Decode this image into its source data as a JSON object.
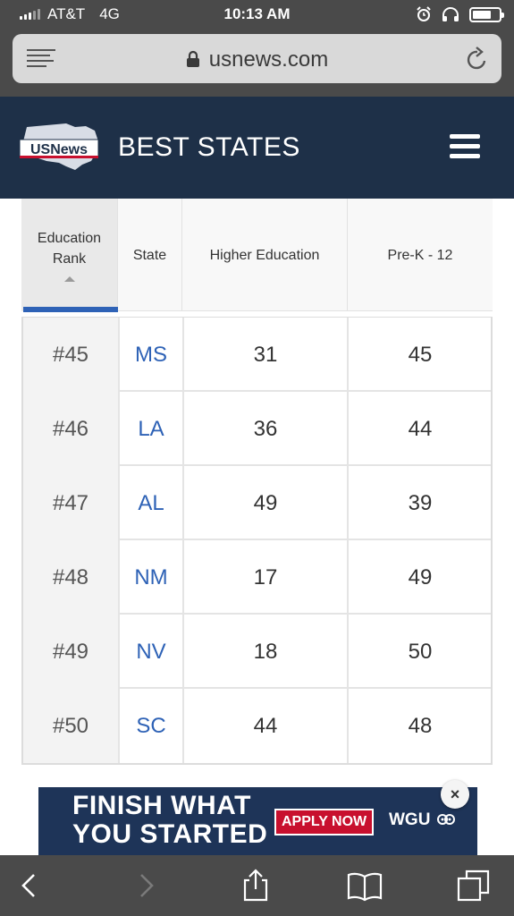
{
  "status_bar": {
    "carrier": "AT&T",
    "network": "4G",
    "time": "10:13 AM",
    "battery_level": 0.7
  },
  "browser": {
    "url": "usnews.com"
  },
  "site": {
    "logo_text": "USNews",
    "title": "BEST STATES"
  },
  "table": {
    "columns": [
      "Education Rank",
      "State",
      "Higher Education",
      "Pre-K - 12"
    ],
    "rows": [
      {
        "rank": "#45",
        "state": "MS",
        "higher_ed": "31",
        "prek12": "45"
      },
      {
        "rank": "#46",
        "state": "LA",
        "higher_ed": "36",
        "prek12": "44"
      },
      {
        "rank": "#47",
        "state": "AL",
        "higher_ed": "49",
        "prek12": "39"
      },
      {
        "rank": "#48",
        "state": "NM",
        "higher_ed": "17",
        "prek12": "49"
      },
      {
        "rank": "#49",
        "state": "NV",
        "higher_ed": "18",
        "prek12": "50"
      },
      {
        "rank": "#50",
        "state": "SC",
        "higher_ed": "44",
        "prek12": "48"
      }
    ]
  },
  "ad": {
    "line1": "FINISH WHAT",
    "line2": "YOU STARTED",
    "cta": "APPLY NOW",
    "brand": "WGU",
    "close": "×"
  },
  "colors": {
    "status_bg": "#4a4a4a",
    "header_bg": "#1e3048",
    "link_blue": "#2e62b6",
    "ad_bg": "#1e3458",
    "cta_red": "#c8102e"
  },
  "icons": [
    "menu-lines-icon",
    "lock-icon",
    "reload-icon",
    "hamburger-icon",
    "sort-ascending-icon",
    "back-icon",
    "forward-icon",
    "share-icon",
    "bookmarks-icon",
    "tabs-icon",
    "close-icon",
    "alarm-icon",
    "headphones-icon",
    "battery-icon",
    "signal-icon"
  ]
}
